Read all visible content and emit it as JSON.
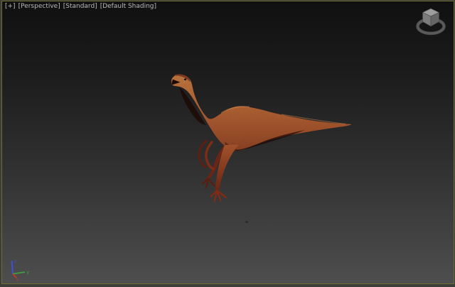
{
  "viewport_header": {
    "general_menu": "[+]",
    "pov_menu": "[Perspective]",
    "style_menu": "[Standard]",
    "shading_menu": "[Default Shading]"
  },
  "axis_gizmo": {
    "x_label": "x",
    "y_label": "y",
    "z_label": "z"
  },
  "colors": {
    "accent_border": "#6e6b33",
    "frame": "#3d3d3a",
    "bg_top": "#101010",
    "bg_bottom": "#4e4e4e",
    "label_text": "#b9b9b9",
    "dino_base": "#b9622f",
    "dino_light": "#d08747",
    "dino_dark": "#7e331a",
    "dino_limb": "#6e2414",
    "dino_limb_near": "#93401f",
    "dino_shadow": "#1c0904",
    "mouth_dark": "#200a06",
    "axis_x": "#bf3a2b",
    "axis_y": "#3fa03f",
    "axis_z": "#3d52d8",
    "cube_top": "#9d9d9d",
    "cube_left": "#7b7b7b",
    "cube_right": "#656565",
    "cube_ring": "#575757"
  }
}
